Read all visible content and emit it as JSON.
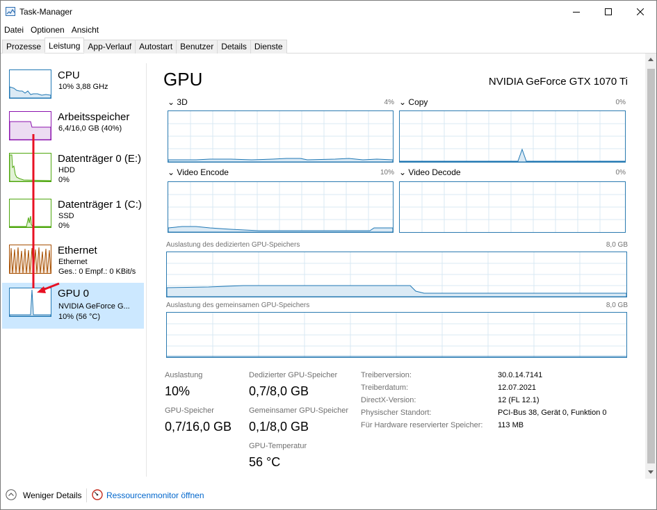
{
  "window": {
    "title": "Task-Manager"
  },
  "menu": [
    "Datei",
    "Optionen",
    "Ansicht"
  ],
  "tabs": [
    "Prozesse",
    "Leistung",
    "App-Verlauf",
    "Autostart",
    "Benutzer",
    "Details",
    "Dienste"
  ],
  "sidebar": {
    "items": [
      {
        "name": "CPU",
        "sub1": "10% 3,88 GHz",
        "sub2": "",
        "color": "#1f77b4"
      },
      {
        "name": "Arbeitsspeicher",
        "sub1": "6,4/16,0 GB (40%)",
        "sub2": "",
        "color": "#8b12ae"
      },
      {
        "name": "Datenträger 0 (E:)",
        "sub1": "HDD",
        "sub2": "0%",
        "color": "#4da60c"
      },
      {
        "name": "Datenträger 1 (C:)",
        "sub1": "SSD",
        "sub2": "0%",
        "color": "#4da60c"
      },
      {
        "name": "Ethernet",
        "sub1": "Ethernet",
        "sub2": "Ges.: 0 Empf.: 0 KBit/s",
        "color": "#a74f01"
      },
      {
        "name": "GPU 0",
        "sub1": "NVIDIA GeForce G...",
        "sub2": "10% (56 °C)",
        "color": "#1f77b4"
      }
    ]
  },
  "main": {
    "title": "GPU",
    "model": "NVIDIA GeForce GTX 1070 Ti",
    "engines": [
      {
        "label": "3D",
        "pct": "4%"
      },
      {
        "label": "Copy",
        "pct": "0%"
      },
      {
        "label": "Video Encode",
        "pct": "10%"
      },
      {
        "label": "Video Decode",
        "pct": "0%"
      }
    ],
    "dedicated_label": "Auslastung des dedizierten GPU-Speichers",
    "dedicated_max": "8,0 GB",
    "shared_label": "Auslastung des gemeinsamen GPU-Speichers",
    "shared_max": "8,0 GB",
    "stats": {
      "auslastung_label": "Auslastung",
      "auslastung_value": "10%",
      "gpu_speicher_label": "GPU-Speicher",
      "gpu_speicher_value": "0,7/16,0 GB",
      "dediziert_label": "Dedizierter GPU-Speicher",
      "dediziert_value": "0,7/8,0 GB",
      "gemeinsam_label": "Gemeinsamer GPU-Speicher",
      "gemeinsam_value": "0,1/8,0 GB",
      "temp_label": "GPU-Temperatur",
      "temp_value": "56 °C"
    },
    "info": [
      {
        "key": "Treiberversion:",
        "value": "30.0.14.7141"
      },
      {
        "key": "Treiberdatum:",
        "value": "12.07.2021"
      },
      {
        "key": "DirectX-Version:",
        "value": "12 (FL 12.1)"
      },
      {
        "key": "Physischer Standort:",
        "value": "PCI-Bus 38, Gerät 0, Funktion 0"
      },
      {
        "key": "Für Hardware reservierter Speicher:",
        "value": "113 MB"
      }
    ]
  },
  "footer": {
    "less_details": "Weniger Details",
    "resource_monitor": "Ressourcenmonitor öffnen"
  },
  "colors": {
    "graph_border": "#2a7ab0",
    "selected_bg": "#cce8ff",
    "arrow": "#e81123",
    "link": "#0066cc"
  }
}
